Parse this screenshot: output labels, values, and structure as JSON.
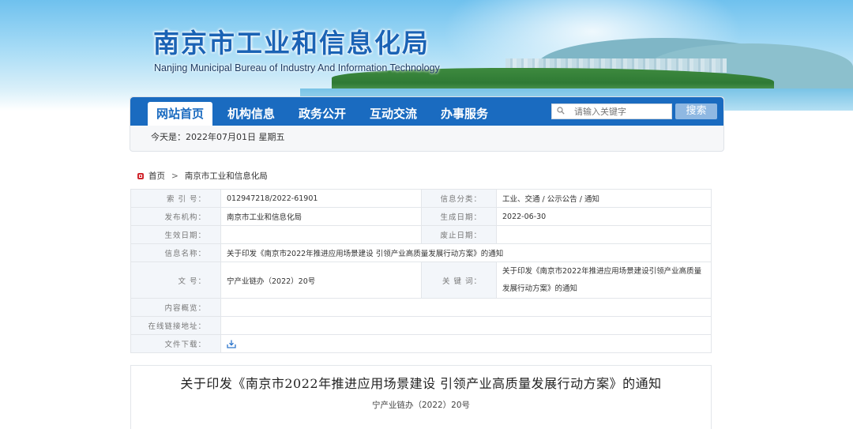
{
  "site": {
    "title": "南京市工业和信息化局",
    "subtitle": "Nanjing Municipal Bureau of Industry And Information Technology"
  },
  "nav": {
    "items": [
      {
        "label": "网站首页",
        "active": true
      },
      {
        "label": "机构信息",
        "active": false
      },
      {
        "label": "政务公开",
        "active": false
      },
      {
        "label": "互动交流",
        "active": false
      },
      {
        "label": "办事服务",
        "active": false
      }
    ],
    "search_placeholder": "请输入关键字",
    "search_button": "搜索"
  },
  "date_bar": {
    "text": "今天是：2022年07月01日  星期五"
  },
  "breadcrumb": {
    "home": "首页",
    "separator": ">",
    "current": "南京市工业和信息化局"
  },
  "info_table": {
    "index_label": "索  引  号：",
    "index_value": "012947218/2022-61901",
    "category_label": "信息分类：",
    "category_value": "工业、交通  /  公示公告  /  通知",
    "publisher_label": "发布机构：",
    "publisher_value": "南京市工业和信息化局",
    "generated_label": "生成日期：",
    "generated_value": "2022-06-30",
    "effective_label": "生效日期：",
    "effective_value": "",
    "expiry_label": "废止日期：",
    "expiry_value": "",
    "name_label": "信息名称：",
    "name_value": "关于印发《南京市2022年推进应用场景建设  引领产业高质量发展行动方案》的通知",
    "docno_label": "文      号：",
    "docno_value": "宁产业链办（2022）20号",
    "keywords_label": "关  键  词：",
    "keywords_value": "关于印发《南京市2022年推进应用场景建设引领产业高质量发展行动方案》的通知",
    "summary_label": "内容概览：",
    "summary_value": "",
    "link_label": "在线链接地址：",
    "link_value": "",
    "download_label": "文件下载："
  },
  "article": {
    "title": "关于印发《南京市2022年推进应用场景建设  引领产业高质量发展行动方案》的通知",
    "doc_number": "宁产业链办（2022）20号"
  },
  "colors": {
    "nav_blue": "#1a6bc0",
    "title_blue": "#1b63b5",
    "search_button": "#8fb8e2",
    "home_icon_red": "#d0262d"
  }
}
